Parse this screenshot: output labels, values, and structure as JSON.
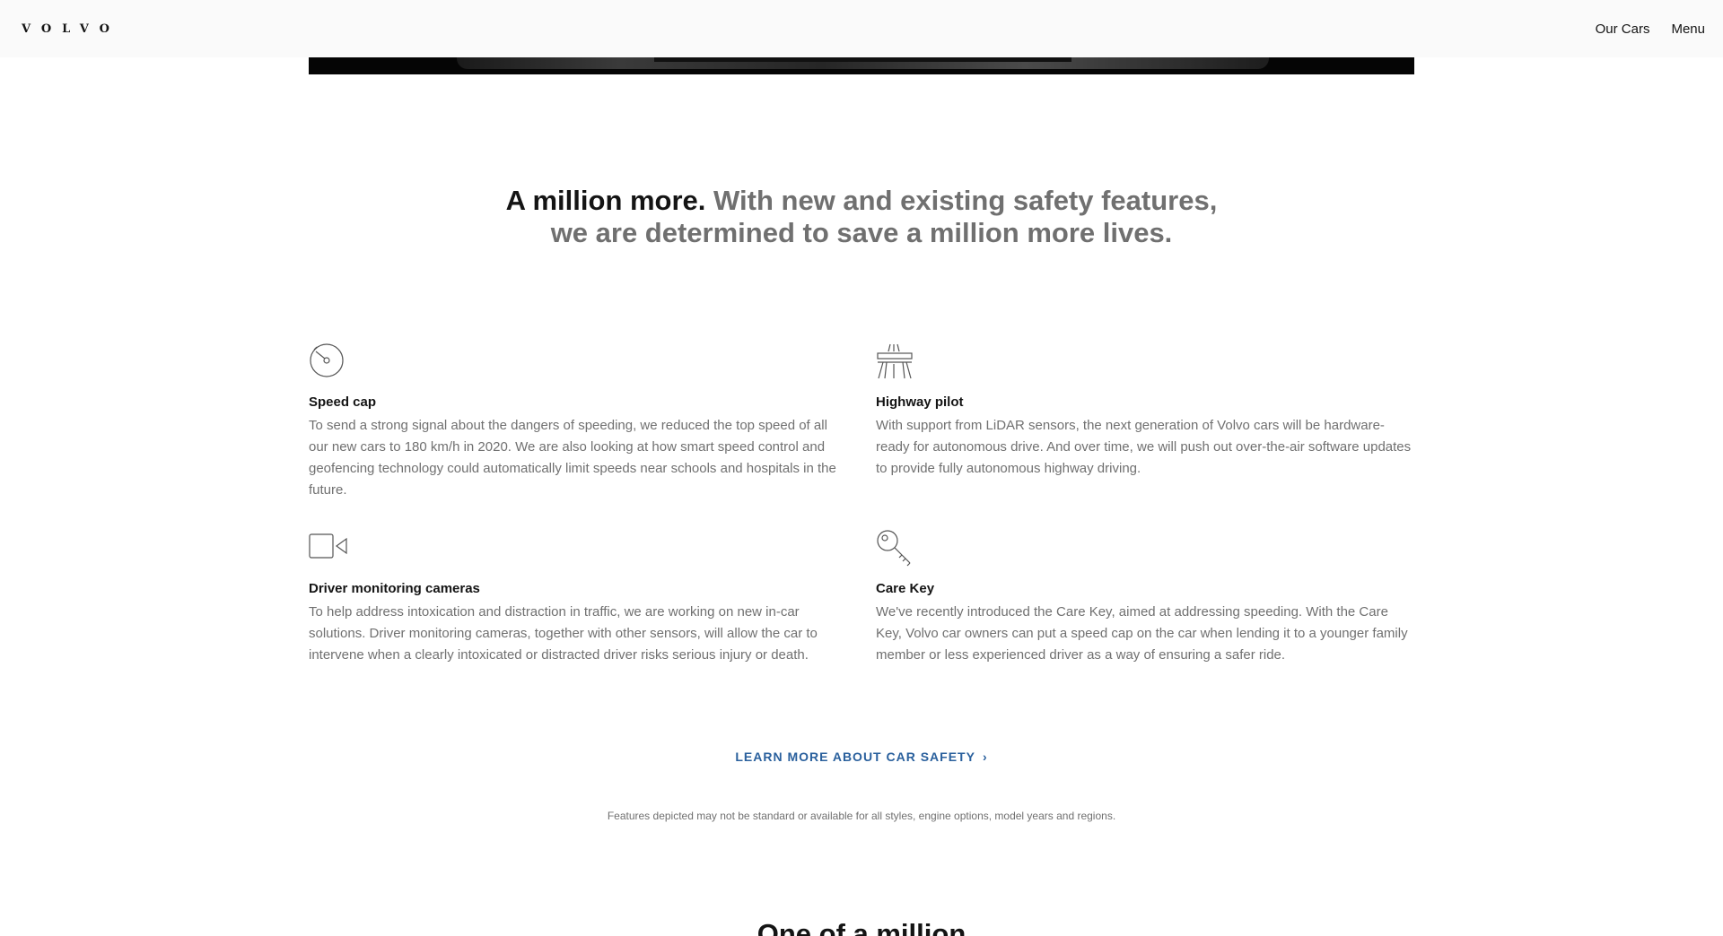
{
  "header": {
    "logo": "VOLVO",
    "nav": [
      "Our Cars",
      "Menu"
    ]
  },
  "headline": {
    "strong": "A million more.",
    "rest": " With new and existing safety features, we are determined to save a million more lives."
  },
  "features": [
    {
      "icon": "speedometer-icon",
      "title": "Speed cap",
      "body": "To send a strong signal about the dangers of speeding, we reduced the top speed of all our new cars to 180 km/h in 2020. We are also looking at how smart speed control and geofencing technology could automatically limit speeds near schools and hospitals in the future."
    },
    {
      "icon": "highway-icon",
      "title": "Highway pilot",
      "body": "With support from LiDAR sensors, the next generation of Volvo cars will be hardware-ready for autonomous drive. And over time, we will push out over-the-air software updates to provide fully autonomous highway driving."
    },
    {
      "icon": "camera-icon",
      "title": "Driver monitoring cameras",
      "body": "To help address intoxication and distraction in traffic, we are working on new in-car solutions. Driver monitoring cameras, together with other sensors, will allow the car to intervene when a clearly intoxicated or distracted driver risks serious injury or death."
    },
    {
      "icon": "key-icon",
      "title": "Care Key",
      "body": "We've recently introduced the Care Key, aimed at addressing speeding. With the Care Key, Volvo car owners can put a speed cap on the car when lending it to a younger family member or less experienced driver as a way of ensuring a safer ride."
    }
  ],
  "cta": {
    "label": "LEARN MORE ABOUT CAR SAFETY",
    "chevron": "›"
  },
  "disclaimer": "Features depicted may not be standard or available for all styles, engine options, model years and regions.",
  "next_section_title": "One of a million",
  "colors": {
    "accent": "#2a609d",
    "text_dark": "#141414",
    "text_muted": "#707070",
    "header_bg": "#fafafa"
  }
}
